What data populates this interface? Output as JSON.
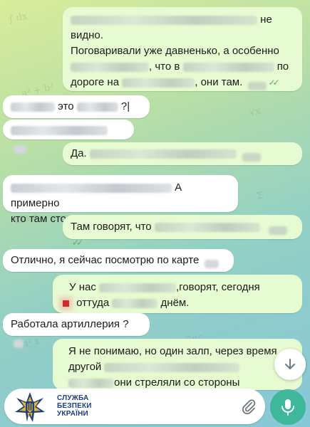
{
  "messages": [
    {
      "id": "m1",
      "direction": "outgoing",
      "line1_tail": "не",
      "line2": "видно.",
      "line3": "Поговаривали уже давненько, а особенно",
      "line4_middle": ", что в",
      "line4_tail": "по",
      "line5_start": "дороге на",
      "line5_tail": ", они там."
    },
    {
      "id": "m2",
      "direction": "incoming",
      "text_middle": "это",
      "text_tail": "?|"
    },
    {
      "id": "m3",
      "direction": "incoming"
    },
    {
      "id": "m4",
      "direction": "outgoing",
      "text_start": "Да."
    },
    {
      "id": "m5",
      "direction": "incoming",
      "line1_tail": "А примерно",
      "line2": "кто там стоит не понимаем ?"
    },
    {
      "id": "m6",
      "direction": "outgoing",
      "text_start": "Там говорят, что"
    },
    {
      "id": "m7",
      "direction": "incoming",
      "text": "Отлично, я сейчас посмотрю по карте"
    },
    {
      "id": "m8",
      "direction": "outgoing",
      "line1_start": "У нас",
      "line1_tail": ",говорят, сегодня",
      "line2_start": "оттуда",
      "line2_tail": "днём."
    },
    {
      "id": "m9",
      "direction": "incoming",
      "text": "Работала артиллерия ?"
    },
    {
      "id": "m10",
      "direction": "outgoing",
      "line1": "Я не понимаю, но один залп, через время",
      "line2_start": "другой",
      "line3_tail": "они стреляли со стороны"
    }
  ],
  "logo": {
    "line1": "СЛУЖБА",
    "line2": "БЕЗПЕКИ",
    "line3": "УКРАЇНИ"
  },
  "icons": {
    "scroll_down": "chevron-down-icon",
    "attach": "paperclip-icon",
    "mic": "microphone-icon",
    "logo": "sbu-emblem-icon"
  },
  "colors": {
    "outgoing_bubble": "#e7fbd2",
    "incoming_bubble": "#ffffff",
    "read_ticks": "#5fae5c",
    "mic_button": "#3fb79a",
    "logo_blue": "#1f3f7a",
    "logo_gold": "#e1b43a"
  }
}
